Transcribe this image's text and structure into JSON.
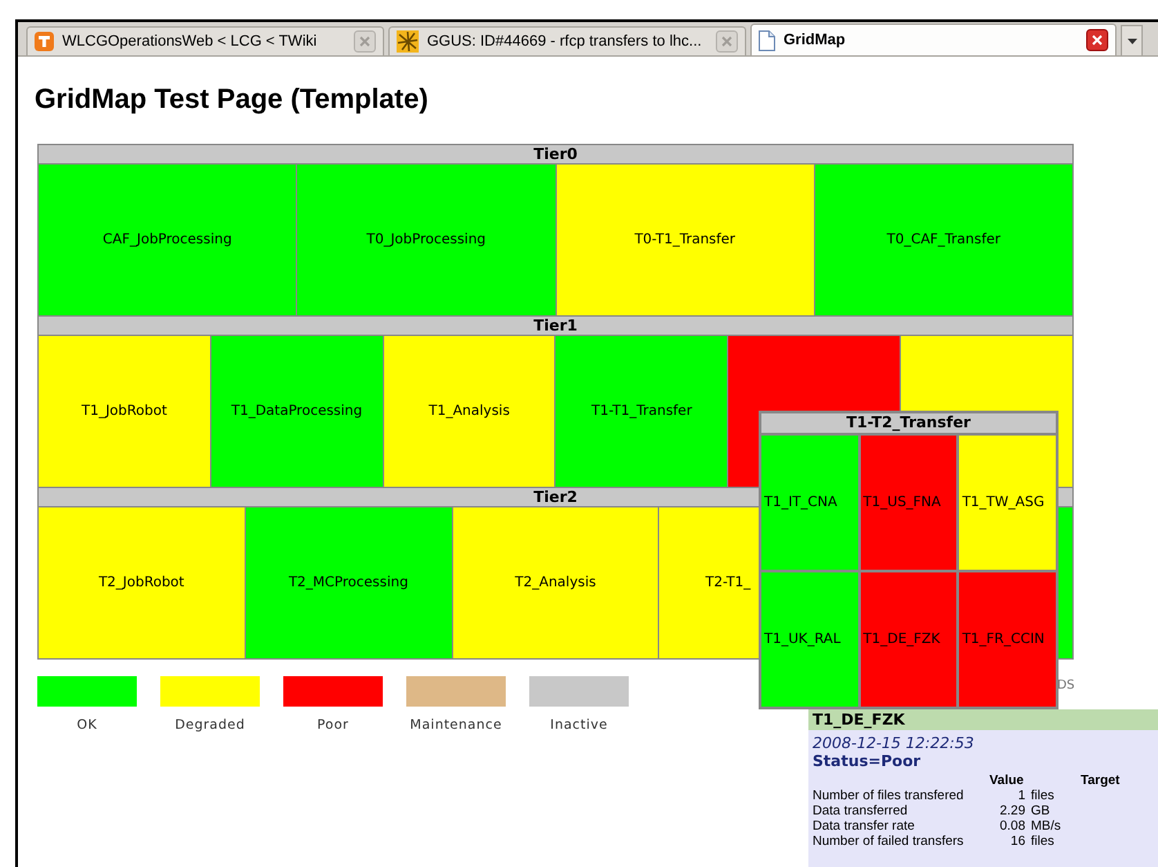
{
  "tabs": [
    {
      "title": "WLCGOperationsWeb < LCG < TWiki",
      "selected": false
    },
    {
      "title": "GGUS: ID#44669 - rfcp transfers to lhc...",
      "selected": false
    },
    {
      "title": "GridMap",
      "selected": true
    }
  ],
  "heading": "GridMap Test Page (Template)",
  "tiers": [
    {
      "name": "Tier0",
      "tiles": [
        {
          "label": "CAF_JobProcessing",
          "color": "#00ff00"
        },
        {
          "label": "T0_JobProcessing",
          "color": "#00ff00"
        },
        {
          "label": "T0-T1_Transfer",
          "color": "#ffff00"
        },
        {
          "label": "T0_CAF_Transfer",
          "color": "#00ff00"
        }
      ]
    },
    {
      "name": "Tier1",
      "tiles": [
        {
          "label": "T1_JobRobot",
          "color": "#ffff00"
        },
        {
          "label": "T1_DataProcessing",
          "color": "#00ff00"
        },
        {
          "label": "T1_Analysis",
          "color": "#ffff00"
        },
        {
          "label": "T1-T1_Transfer",
          "color": "#00ff00"
        },
        {
          "color": "#ff0000"
        },
        {
          "color": "#ffff00"
        }
      ]
    },
    {
      "name": "Tier2",
      "tiles": [
        {
          "label": "T2_JobRobot",
          "color": "#ffff00"
        },
        {
          "label": "T2_MCProcessing",
          "color": "#00ff00"
        },
        {
          "label": "T2_Analysis",
          "color": "#ffff00"
        },
        {
          "label": "T2-T1_",
          "color": "#ffff00",
          "clipped": true
        },
        {
          "color": "#00ff00"
        }
      ]
    }
  ],
  "map_note": "DS",
  "legend": [
    {
      "label": "OK",
      "color": "#00ff00"
    },
    {
      "label": "Degraded",
      "color": "#ffff00"
    },
    {
      "label": "Poor",
      "color": "#ff0000"
    },
    {
      "label": "Maintenance",
      "color": "#deb887"
    },
    {
      "label": "Inactive",
      "color": "#c8c8c8"
    }
  ],
  "zoom_panel": {
    "title": "T1-T2_Transfer",
    "tiles": [
      {
        "label": "T1_IT_CNA",
        "color": "#00ff00"
      },
      {
        "label": "T1_US_FNA",
        "color": "#ff0000"
      },
      {
        "label": "T1_TW_ASG",
        "color": "#ffff00"
      },
      {
        "label": "T1_UK_RAL",
        "color": "#00ff00"
      },
      {
        "label": "T1_DE_FZK",
        "color": "#ff0000"
      },
      {
        "label": "T1_FR_CCIN",
        "color": "#ff0000"
      }
    ]
  },
  "tooltip": {
    "title": "T1_DE_FZK",
    "time": "2008-12-15 12:22:53",
    "status": "Status=Poor",
    "columns": [
      "Value",
      "Target"
    ],
    "rows": [
      {
        "metric": "Number of files transfered",
        "value": "1",
        "unit": "files"
      },
      {
        "metric": "Data transferred",
        "value": "2.29",
        "unit": "GB"
      },
      {
        "metric": "Data transfer rate",
        "value": "0.08",
        "unit": "MB/s"
      },
      {
        "metric": "Number of failed transfers",
        "value": "16",
        "unit": "files"
      }
    ]
  }
}
